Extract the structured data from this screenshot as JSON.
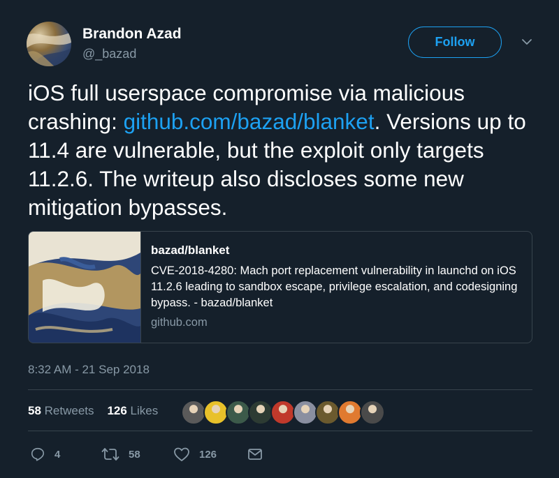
{
  "author": {
    "display_name": "Brandon Azad",
    "handle": "@_bazad"
  },
  "follow_button": {
    "label": "Follow"
  },
  "tweet": {
    "text_before_link": "iOS full userspace compromise via malicious crashing: ",
    "link_text": "github.com/bazad/blanket",
    "text_after_link": ". Versions up to 11.4 are vulnerable, but the exploit only targets 11.2.6. The writeup also discloses some new mitigation bypasses."
  },
  "card": {
    "title": "bazad/blanket",
    "description": "CVE-2018-4280: Mach port replacement vulnerability in launchd on iOS 11.2.6 leading to sandbox escape, privilege escalation, and codesigning bypass. - bazad/blanket",
    "domain": "github.com"
  },
  "timestamp": "8:32 AM - 21 Sep 2018",
  "stats": {
    "retweets_count": "58",
    "retweets_label": "Retweets",
    "likes_count": "126",
    "likes_label": "Likes"
  },
  "likers": [
    {
      "name": "liker-avatar-1",
      "color": "#5a5a5a"
    },
    {
      "name": "liker-avatar-2",
      "color": "#e8c12a"
    },
    {
      "name": "liker-avatar-3",
      "color": "#3c5a4a"
    },
    {
      "name": "liker-avatar-4",
      "color": "#2d3b33"
    },
    {
      "name": "liker-avatar-5",
      "color": "#c0392b"
    },
    {
      "name": "liker-avatar-6",
      "color": "#8a8fa0"
    },
    {
      "name": "liker-avatar-7",
      "color": "#6b5a2e"
    },
    {
      "name": "liker-avatar-8",
      "color": "#e07a30"
    },
    {
      "name": "liker-avatar-9",
      "color": "#4a4a4a"
    }
  ],
  "actions": {
    "reply": {
      "icon": "reply-icon",
      "count": "4"
    },
    "retweet": {
      "icon": "retweet-icon",
      "count": "58"
    },
    "like": {
      "icon": "heart-icon",
      "count": "126"
    },
    "message": {
      "icon": "envelope-icon"
    }
  },
  "colors": {
    "background": "#15202b",
    "accent": "#1da1f2",
    "secondary_text": "#8899a6",
    "border": "#38444d"
  }
}
